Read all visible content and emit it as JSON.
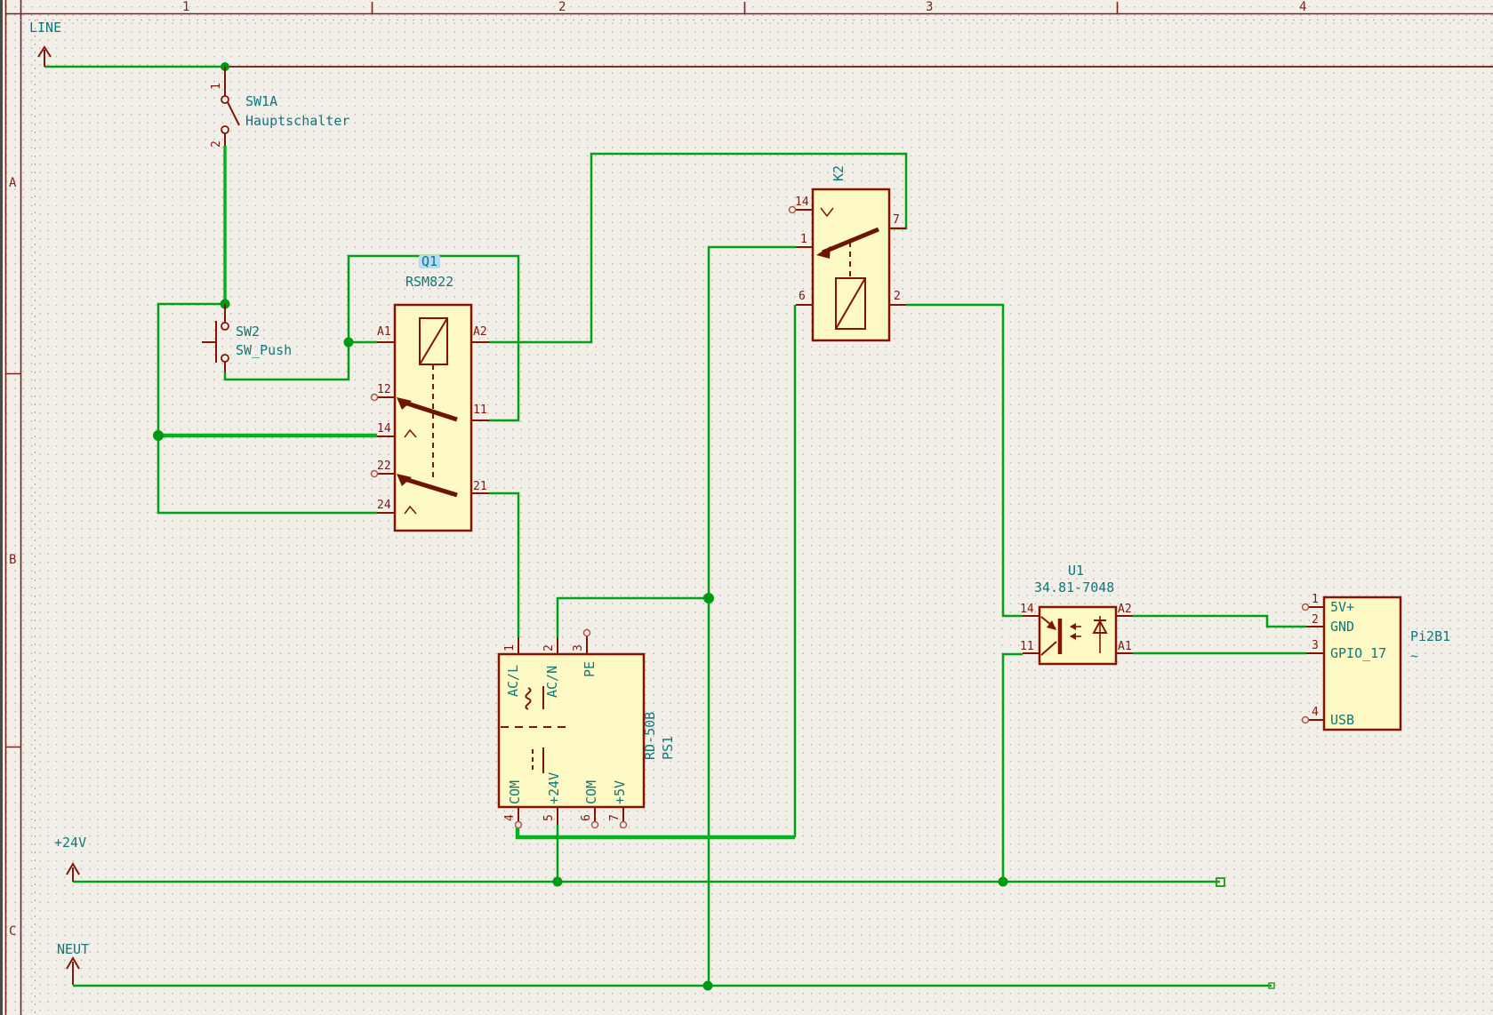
{
  "frame": {
    "columns": [
      "1",
      "2",
      "3",
      "4"
    ],
    "rows": [
      "A",
      "B",
      "C"
    ]
  },
  "net_labels": {
    "line": "LINE",
    "p24v": "+24V",
    "neut": "NEUT"
  },
  "components": {
    "sw1": {
      "ref": "SW1A",
      "value": "Hauptschalter",
      "pin1": "1",
      "pin2": "2"
    },
    "sw2": {
      "ref": "SW2",
      "value": "SW_Push"
    },
    "q1": {
      "ref": "Q1",
      "value": "RSM822",
      "pins": {
        "a1": "A1",
        "a2": "A2",
        "p12": "12",
        "p11": "11",
        "p14": "14",
        "p22": "22",
        "p21": "21",
        "p24": "24"
      }
    },
    "k2": {
      "ref": "K2",
      "pins": {
        "p14": "14",
        "p7": "7",
        "p1": "1",
        "p6": "6",
        "p2": "2"
      }
    },
    "ps1": {
      "ref": "PS1",
      "value": "RD-50B",
      "pins": {
        "n1": "1",
        "n2": "2",
        "n3": "3",
        "n4": "4",
        "n5": "5",
        "n6": "6",
        "n7": "7"
      },
      "names": {
        "acl": "AC/L",
        "acn": "AC/N",
        "pe": "PE",
        "com1": "COM",
        "p24": "+24V",
        "com2": "COM",
        "p5": "+5V"
      }
    },
    "u1": {
      "ref": "U1",
      "value": "34.81-7048",
      "pins": {
        "p14": "14",
        "p11": "11",
        "a2": "A2",
        "a1": "A1"
      }
    },
    "pi": {
      "ref": "Pi2B1",
      "value": "~",
      "pins": {
        "n1": "1",
        "n2": "2",
        "n3": "3",
        "n4": "4"
      },
      "names": {
        "p5v": "5V+",
        "gnd": "GND",
        "gpio": "GPIO_17",
        "usb": "USB"
      }
    }
  },
  "colors": {
    "wire_green": "#00a114",
    "selected_green": "#00b41e",
    "symbol_maroon": "#841400",
    "text_teal": "#0e787c",
    "body_yellow": "#fdf9c5",
    "frame_red": "#7c231b",
    "line_bus_brown": "#7b2e1f",
    "highlight_blue": "#b5dcf7",
    "background": "#f2efe8"
  }
}
